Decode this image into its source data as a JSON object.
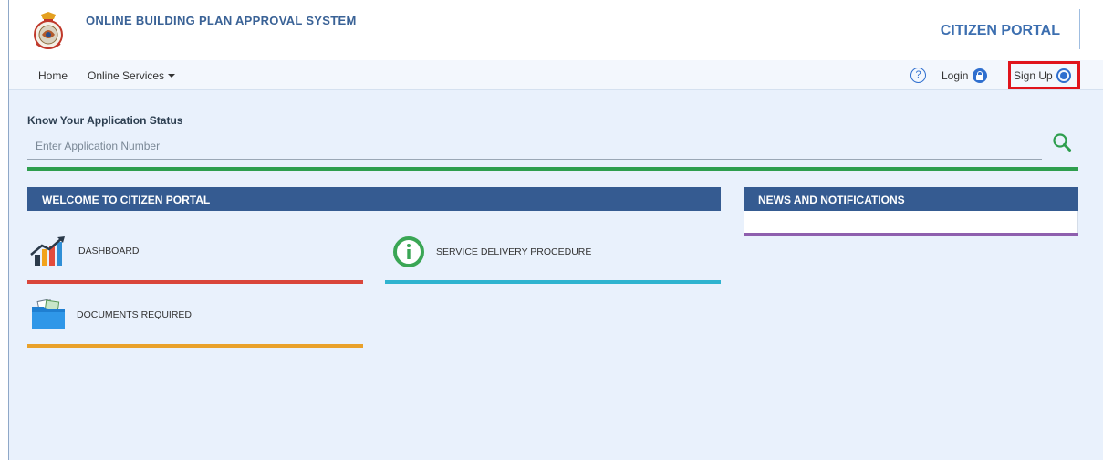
{
  "header": {
    "site_title": "ONLINE BUILDING PLAN APPROVAL SYSTEM",
    "portal_title": "CITIZEN PORTAL"
  },
  "nav": {
    "home": "Home",
    "online_services": "Online Services",
    "help_glyph": "?",
    "login": "Login",
    "signup": "Sign Up"
  },
  "status": {
    "label": "Know Your Application Status",
    "placeholder": "Enter Application Number"
  },
  "welcome": {
    "heading": "WELCOME TO CITIZEN PORTAL",
    "tiles": [
      {
        "label": "DASHBOARD",
        "icon": "dashboard-chart-icon",
        "bar_color": "#d9463b"
      },
      {
        "label": "SERVICE DELIVERY PROCEDURE",
        "icon": "info-circle-icon",
        "bar_color": "#2fb3cf"
      },
      {
        "label": "DOCUMENTS REQUIRED",
        "icon": "documents-folder-icon",
        "bar_color": "#e9a12a"
      }
    ]
  },
  "news": {
    "heading": "NEWS AND NOTIFICATIONS"
  },
  "colors": {
    "brand_blue": "#355b91",
    "accent_green": "#2e9e4e",
    "highlight_red": "#e0141c"
  }
}
